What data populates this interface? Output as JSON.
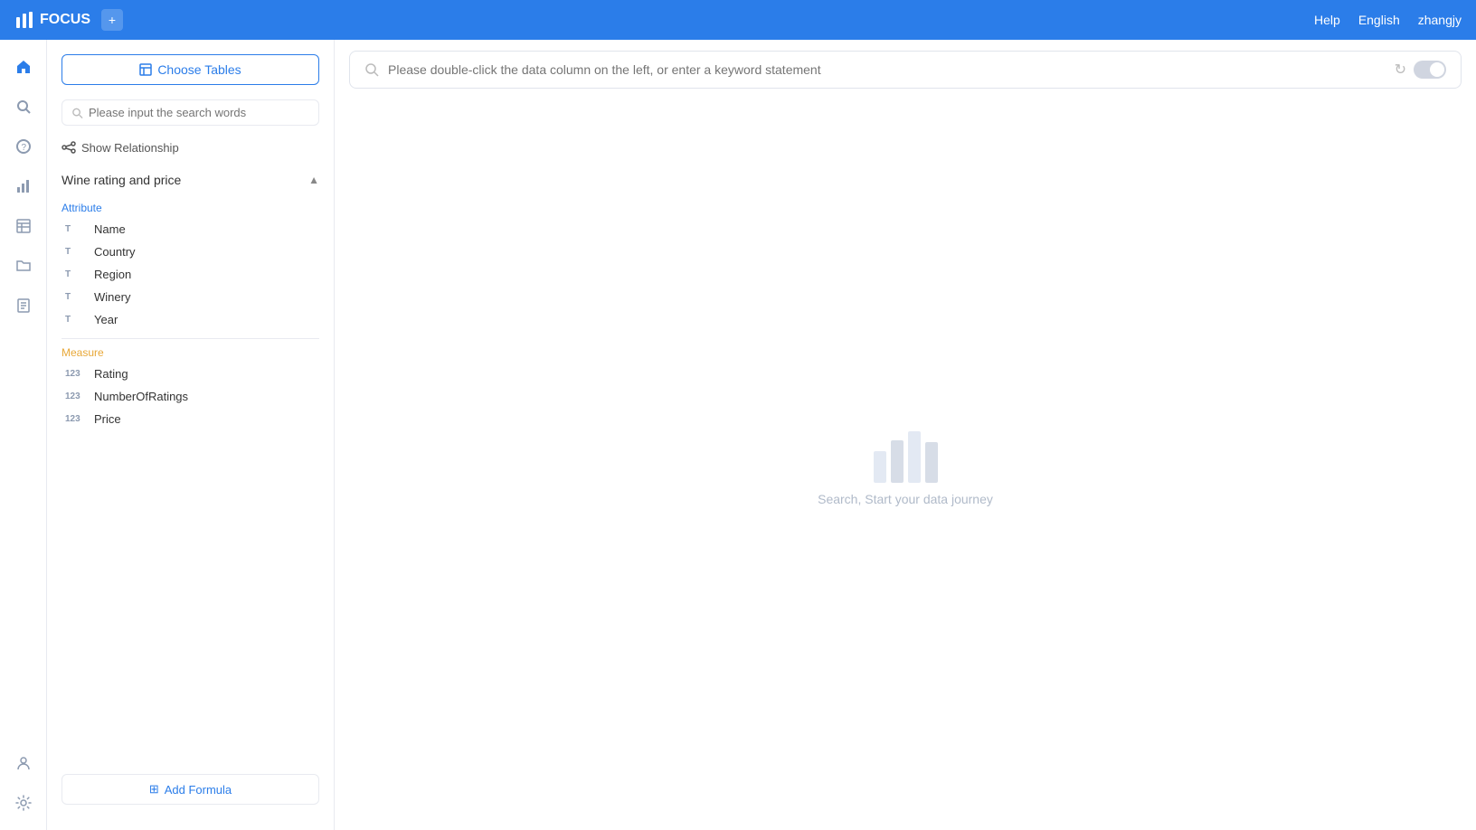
{
  "topNav": {
    "logo": "FOCUS",
    "helpLabel": "Help",
    "languageLabel": "English",
    "userLabel": "zhangjy"
  },
  "leftPanel": {
    "chooseTablesLabel": "Choose Tables",
    "searchPlaceholder": "Please input the search words",
    "showRelationshipLabel": "Show Relationship",
    "tableName": "Wine rating and price",
    "attributeLabel": "Attribute",
    "measureLabel": "Measure",
    "attributeFields": [
      {
        "name": "Name",
        "type": "T"
      },
      {
        "name": "Country",
        "type": "T"
      },
      {
        "name": "Region",
        "type": "T"
      },
      {
        "name": "Winery",
        "type": "T"
      },
      {
        "name": "Year",
        "type": "T"
      }
    ],
    "measureFields": [
      {
        "name": "Rating",
        "type": "123"
      },
      {
        "name": "NumberOfRatings",
        "type": "123"
      },
      {
        "name": "Price",
        "type": "123"
      }
    ],
    "addFormulaLabel": "Add Formula"
  },
  "searchBar": {
    "placeholder": "Please double-click the data column on the left, or enter a keyword statement"
  },
  "emptyState": {
    "text": "Search, Start your data journey"
  }
}
